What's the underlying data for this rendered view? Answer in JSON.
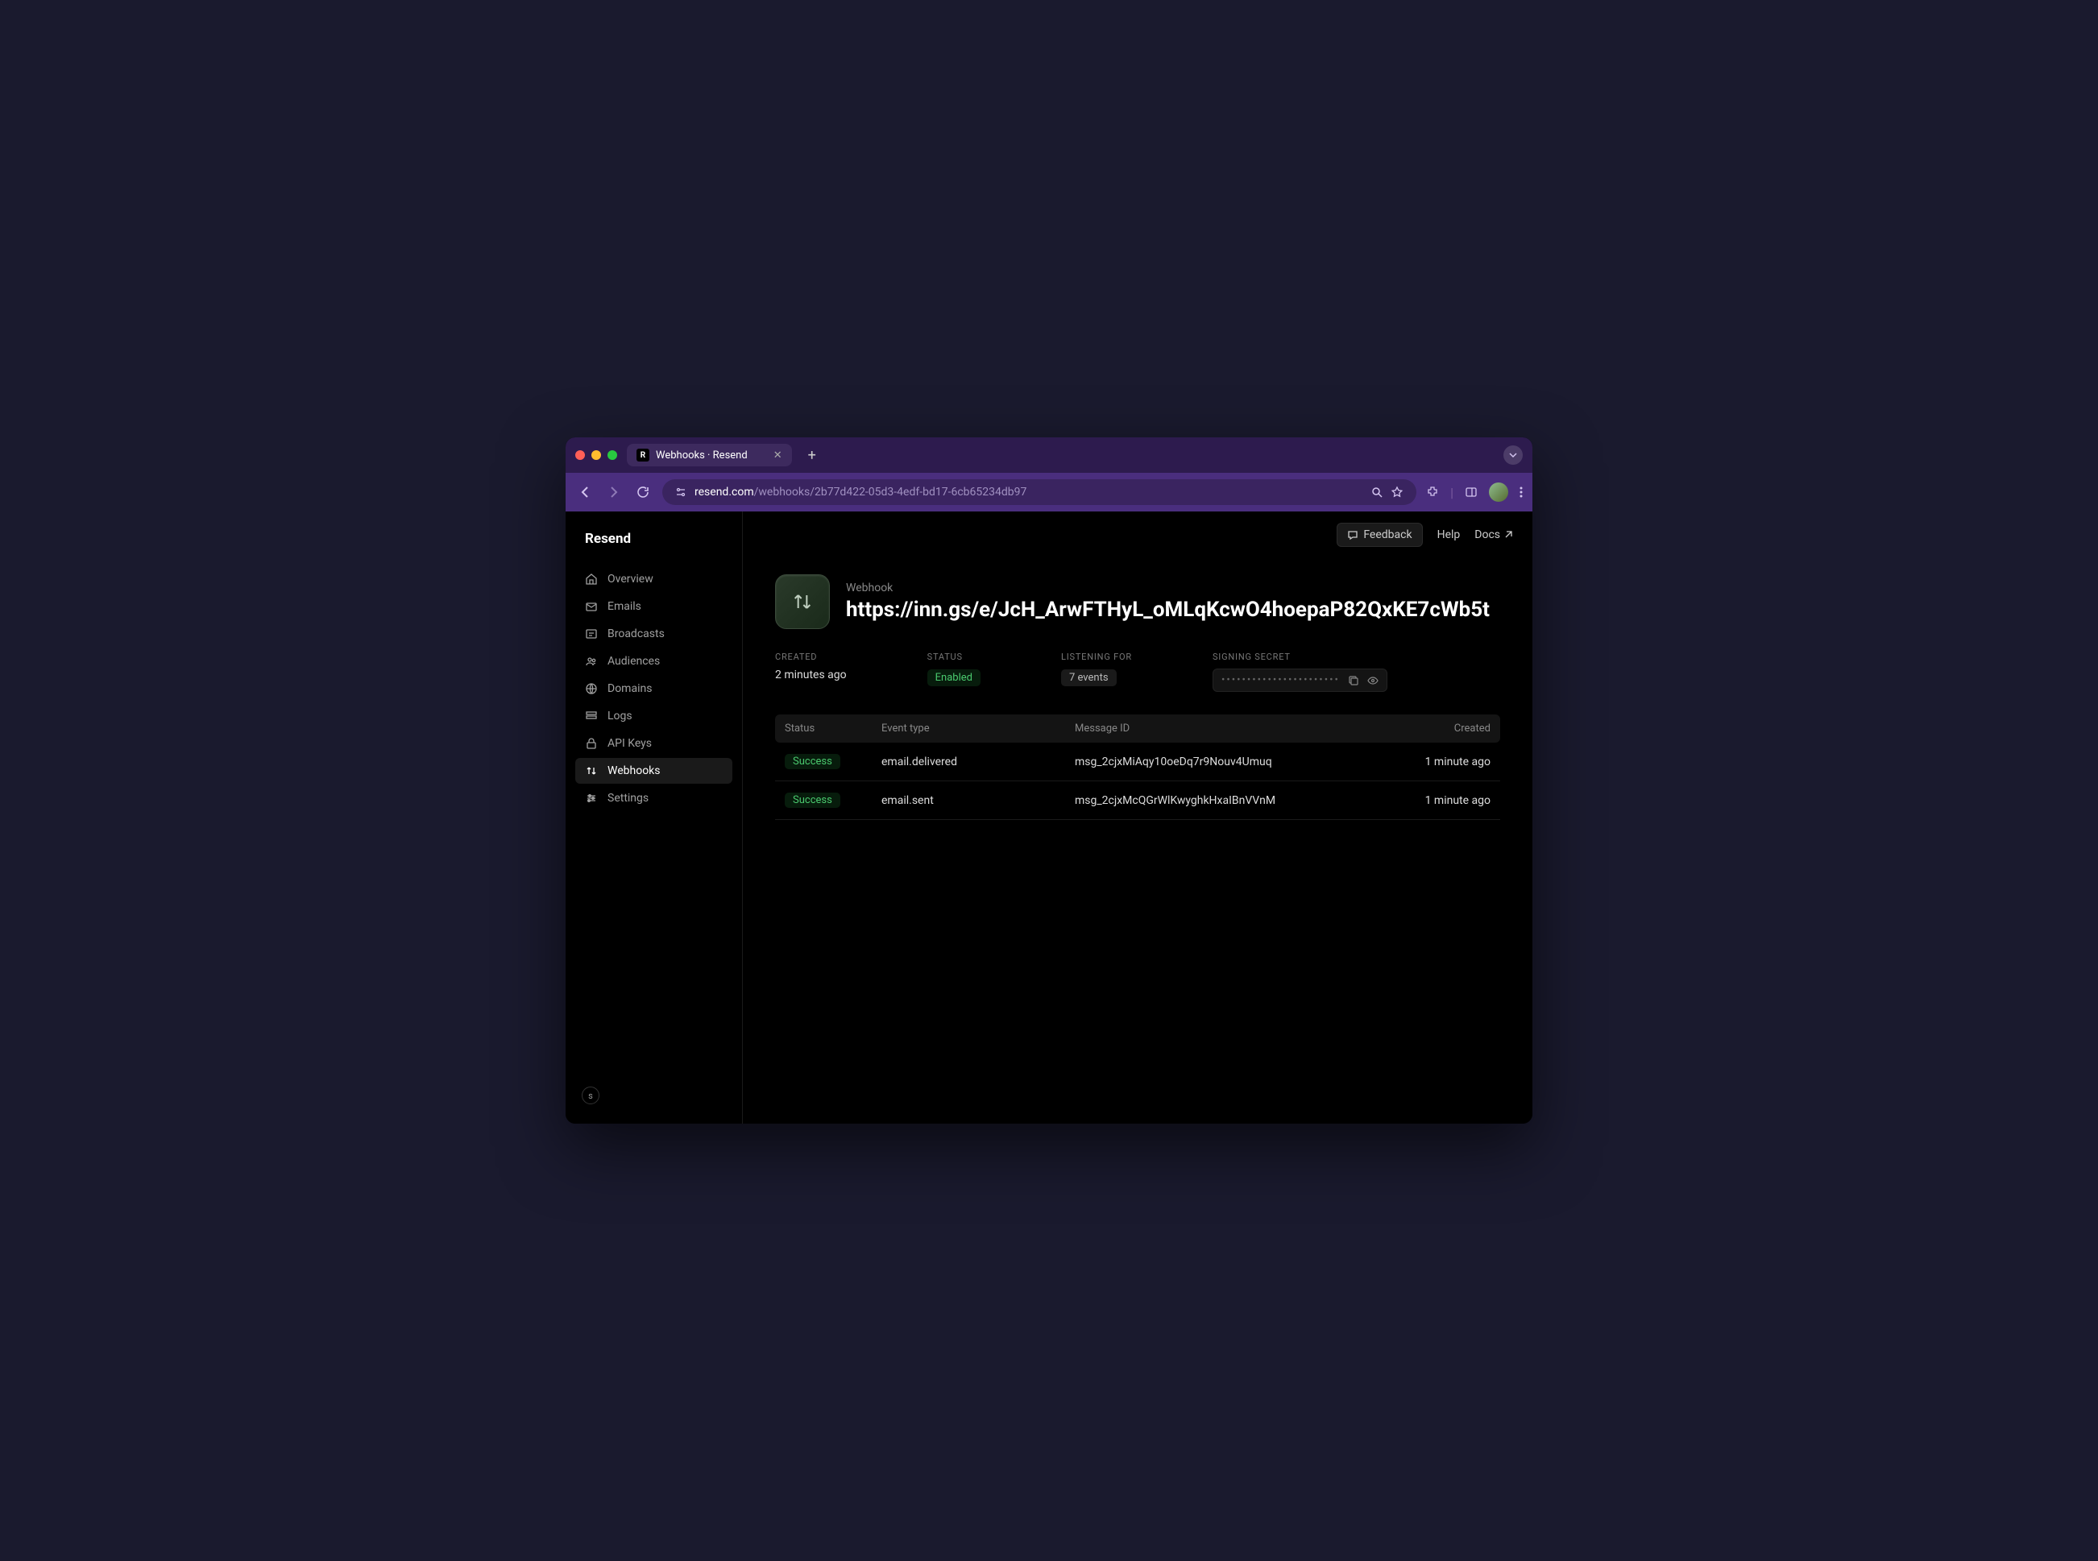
{
  "browser": {
    "tab_title": "Webhooks · Resend",
    "tab_favicon": "R",
    "url_host": "resend.com",
    "url_path": "/webhooks/2b77d422-05d3-4edf-bd17-6cb65234db97"
  },
  "app": {
    "logo": "Resend",
    "header": {
      "feedback": "Feedback",
      "help": "Help",
      "docs": "Docs"
    },
    "sidebar": {
      "items": [
        {
          "icon": "home",
          "label": "Overview"
        },
        {
          "icon": "mail",
          "label": "Emails"
        },
        {
          "icon": "megaphone",
          "label": "Broadcasts"
        },
        {
          "icon": "users",
          "label": "Audiences"
        },
        {
          "icon": "globe",
          "label": "Domains"
        },
        {
          "icon": "logs",
          "label": "Logs"
        },
        {
          "icon": "lock",
          "label": "API Keys"
        },
        {
          "icon": "arrows",
          "label": "Webhooks"
        },
        {
          "icon": "sliders",
          "label": "Settings"
        }
      ],
      "active_index": 7,
      "user_initial": "s"
    },
    "webhook": {
      "kicker": "Webhook",
      "url": "https://inn.gs/e/JcH_ArwFTHyL_oMLqKcwO4hoepaP82QxKE7cWb5t",
      "meta": {
        "created_label": "CREATED",
        "created_value": "2 minutes ago",
        "status_label": "STATUS",
        "status_value": "Enabled",
        "listening_label": "LISTENING FOR",
        "listening_value": "7 events",
        "secret_label": "SIGNING SECRET",
        "secret_mask": "•••••••••••••••••••••••"
      },
      "table": {
        "cols": {
          "status": "Status",
          "event": "Event type",
          "msg": "Message ID",
          "created": "Created"
        },
        "rows": [
          {
            "status": "Success",
            "event": "email.delivered",
            "msg": "msg_2cjxMiAqy10oeDq7r9Nouv4Umuq",
            "created": "1 minute ago"
          },
          {
            "status": "Success",
            "event": "email.sent",
            "msg": "msg_2cjxMcQGrWlKwyghkHxaIBnVVnM",
            "created": "1 minute ago"
          }
        ]
      }
    }
  }
}
